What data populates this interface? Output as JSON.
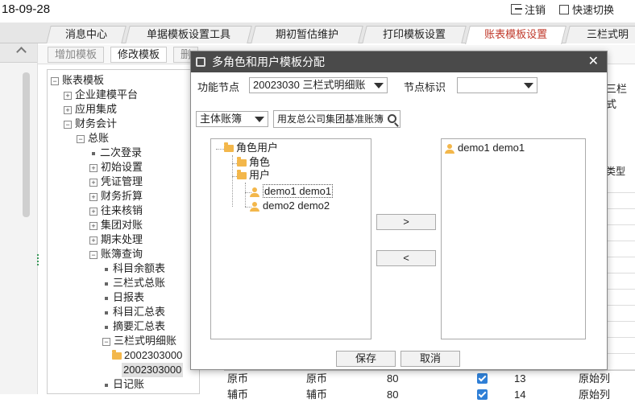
{
  "topbar": {
    "date": "18-09-28",
    "logout": "注销",
    "quick_switch": "快速切换"
  },
  "tabs": [
    "消息中心",
    "单据模板设置工具",
    "期初暂估维护",
    "打印模板设置",
    "账表模板设置",
    "三栏式明"
  ],
  "toolbar": {
    "add_template": "增加模板",
    "edit_template": "修改模板",
    "delete_partial": "删"
  },
  "tree": {
    "root": "账表模板",
    "items": [
      "企业建模平台",
      "应用集成",
      "财务会计",
      "总账",
      "二次登录",
      "初始设置",
      "凭证管理",
      "财务折算",
      "往来核销",
      "集团对账",
      "期末处理",
      "账簿查询",
      "科目余额表",
      "三栏式总账",
      "日报表",
      "科目汇总表",
      "摘要汇总表",
      "三栏式明细账",
      "2002303000",
      "2002303000",
      "日记账"
    ]
  },
  "background": {
    "col_type": "类型",
    "partial_right_label": "三栏式",
    "rows": [
      {
        "c1": "原币",
        "c2": "原币",
        "c3": "80",
        "num": "13",
        "last": "原始列"
      },
      {
        "c1": "辅币",
        "c2": "辅币",
        "c3": "80",
        "num": "14",
        "last": "原始列"
      }
    ]
  },
  "dialog": {
    "title": "多角色和用户模板分配",
    "node_label": "功能节点",
    "node_value": "20023030  三栏式明细账",
    "node_flag_label": "节点标识",
    "node_flag_value": "",
    "book_select": "主体账簿",
    "book_search": "用友总公司集团基准账簿",
    "left_tree": {
      "root": "角色用户",
      "role": "角色",
      "user": "用户",
      "users": [
        "demo1  demo1",
        "demo2  demo2"
      ]
    },
    "right_list": [
      "demo1  demo1"
    ],
    "move_right": ">",
    "move_left": "<",
    "save": "保存",
    "cancel": "取消"
  }
}
